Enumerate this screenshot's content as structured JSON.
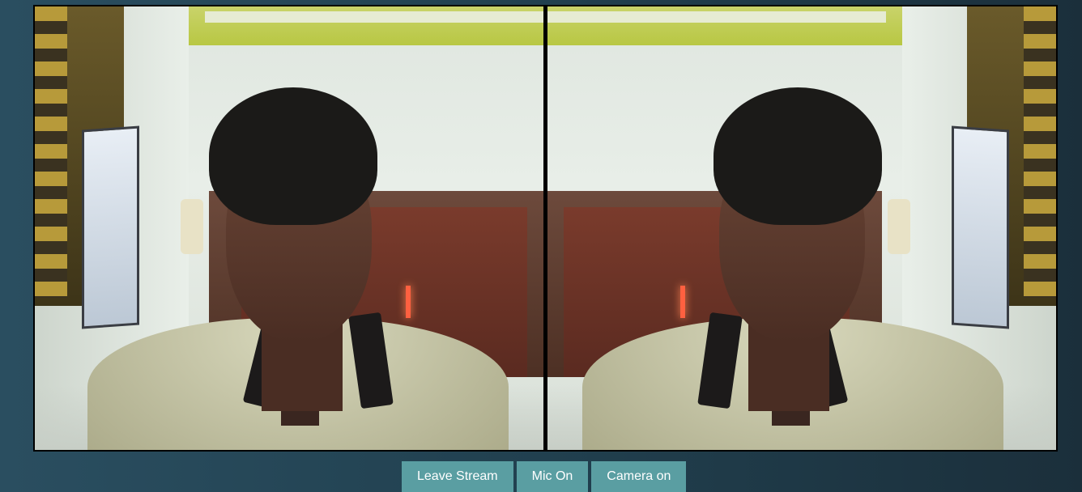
{
  "streams": [
    {
      "mirrored": false
    },
    {
      "mirrored": true
    }
  ],
  "controls": {
    "leave_label": "Leave Stream",
    "mic_label": "Mic On",
    "camera_label": "Camera on"
  },
  "colors": {
    "button_bg": "#5a9ea2",
    "button_text": "#ffffff",
    "background_left": "#2a4e60",
    "background_right": "#1b2f3b"
  }
}
